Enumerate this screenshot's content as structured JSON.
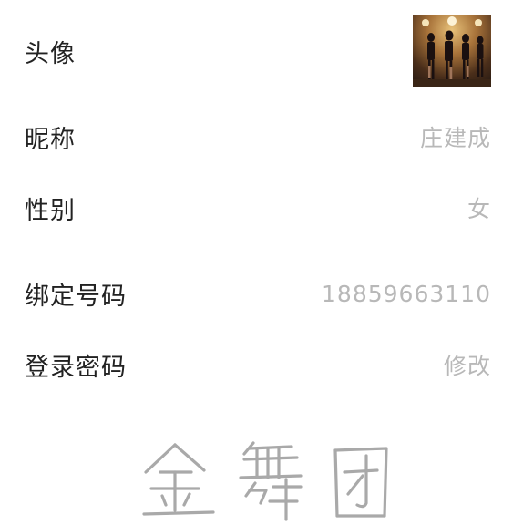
{
  "profile": {
    "avatar": {
      "label": "头像"
    },
    "nickname": {
      "label": "昵称",
      "value": "庄建成"
    },
    "gender": {
      "label": "性别",
      "value": "女"
    },
    "phone": {
      "label": "绑定号码",
      "value": "18859663110"
    },
    "password": {
      "label": "登录密码",
      "value": "修改"
    }
  },
  "brand": {
    "logo_text": "金舞团"
  },
  "colors": {
    "label": "#222222",
    "value": "#b8b8b8",
    "logo": "#a9a9a9"
  }
}
